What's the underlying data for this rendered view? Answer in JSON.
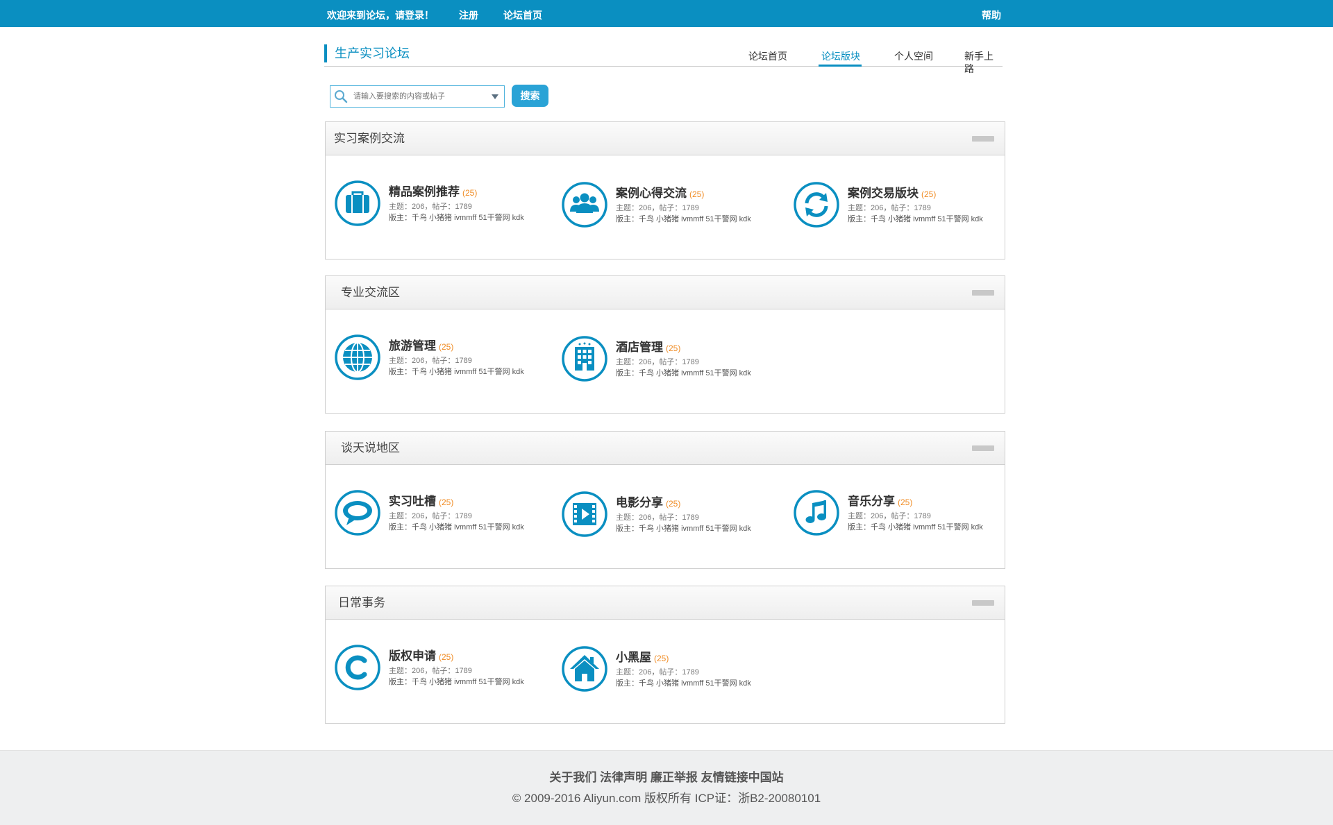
{
  "topbar": {
    "welcome": "欢迎来到论坛，请登录！",
    "register": "注册",
    "forum_home": "论坛首页",
    "help": "帮助"
  },
  "header": {
    "title": "生产实习论坛",
    "nav": [
      "论坛首页",
      "论坛版块",
      "个人空间",
      "新手上路"
    ],
    "active_nav": "论坛版块"
  },
  "search": {
    "placeholder": "请输入要搜索的内容或帖子",
    "button": "搜索"
  },
  "sections": [
    {
      "title": "实习案例交流",
      "boards": [
        {
          "name": "精品案例推荐",
          "count": "(25)",
          "stats": "主题：206，帖子：1789",
          "mods": "版主：千鸟 小猪猪 ivmmff 51干警网 kdk",
          "icon": "briefcase-icon"
        },
        {
          "name": "案例心得交流",
          "count": "(25)",
          "stats": "主题：206，帖子：1789",
          "mods": "版主：千鸟 小猪猪 ivmmff 51干警网 kdk",
          "icon": "users-icon"
        },
        {
          "name": "案例交易版块",
          "count": "(25)",
          "stats": "主题：206，帖子：1789",
          "mods": "版主：千鸟 小猪猪 ivmmff 51干警网 kdk",
          "icon": "refresh-icon"
        }
      ]
    },
    {
      "title": "专业交流区",
      "boards": [
        {
          "name": "旅游管理",
          "count": "(25)",
          "stats": "主题：206，帖子：1789",
          "mods": "版主：千鸟 小猪猪 ivmmff 51干警网 kdk",
          "icon": "globe-icon"
        },
        {
          "name": "酒店管理",
          "count": "(25)",
          "stats": "主题：206，帖子：1789",
          "mods": "版主：千鸟 小猪猪 ivmmff 51干警网 kdk",
          "icon": "hotel-icon"
        }
      ]
    },
    {
      "title": "谈天说地区",
      "boards": [
        {
          "name": "实习吐槽",
          "count": "(25)",
          "stats": "主题：206，帖子：1789",
          "mods": "版主：千鸟 小猪猪 ivmmff 51干警网 kdk",
          "icon": "speech-bubble-icon"
        },
        {
          "name": "电影分享",
          "count": "(25)",
          "stats": "主题：206，帖子：1789",
          "mods": "版主：千鸟 小猪猪 ivmmff 51干警网 kdk",
          "icon": "film-icon"
        },
        {
          "name": "音乐分享",
          "count": "(25)",
          "stats": "主题：206，帖子：1789",
          "mods": "版主：千鸟 小猪猪 ivmmff 51干警网 kdk",
          "icon": "music-note-icon"
        }
      ]
    },
    {
      "title": "日常事务",
      "boards": [
        {
          "name": "版权申请",
          "count": "(25)",
          "stats": "主题：206，帖子：1789",
          "mods": "版主：千鸟 小猪猪 ivmmff 51干警网 kdk",
          "icon": "copyright-icon"
        },
        {
          "name": "小黑屋",
          "count": "(25)",
          "stats": "主题：206，帖子：1789",
          "mods": "版主：千鸟 小猪猪 ivmmff 51干警网 kdk",
          "icon": "home-icon"
        }
      ]
    }
  ],
  "footer": {
    "links": [
      "关于我们",
      "法律声明",
      "廉正举报",
      "友情链接中国站"
    ],
    "copyright": "© 2009-2016 Aliyun.com 版权所有 ICP证：浙B2-20080101"
  },
  "colors": {
    "brand": "#0a8fc1",
    "accent_count": "#f08c24",
    "search_button": "#2aa3d6"
  }
}
